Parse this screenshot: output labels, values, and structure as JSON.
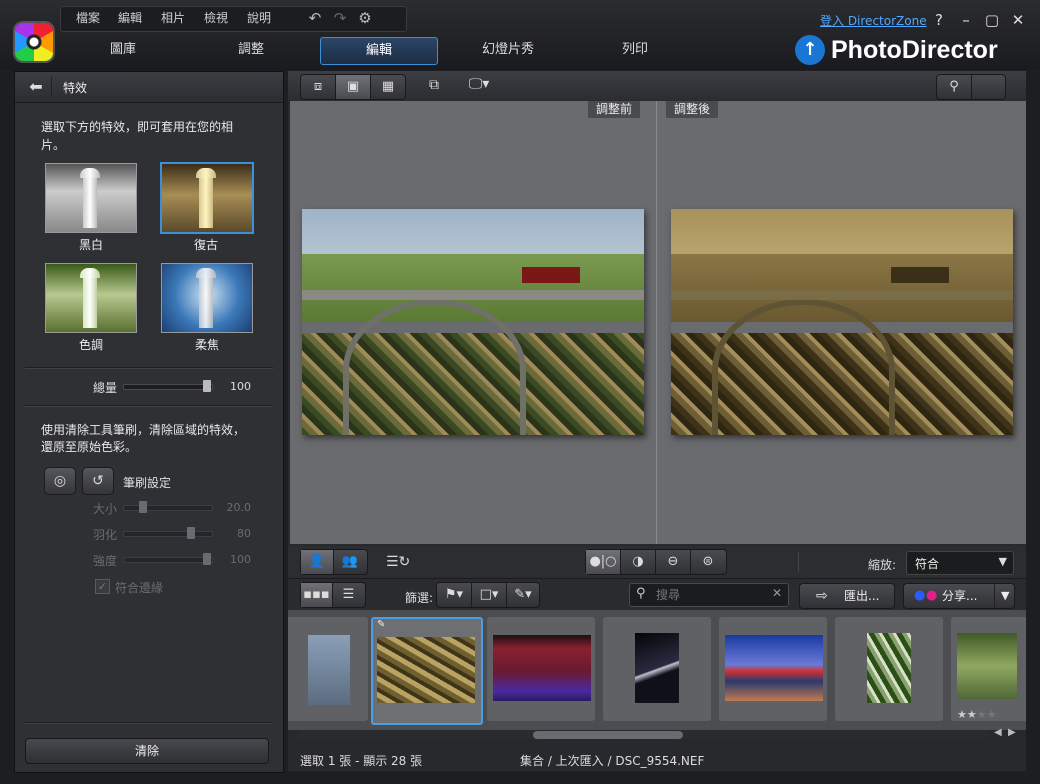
{
  "menu": {
    "file": "檔案",
    "edit": "編輯",
    "photo": "相片",
    "view": "檢視",
    "help": "說明"
  },
  "header": {
    "login": "登入 DirectorZone",
    "help": "?",
    "brand": "PhotoDirector"
  },
  "modes": [
    {
      "label": "圖庫"
    },
    {
      "label": "調整"
    },
    {
      "label": "編輯"
    },
    {
      "label": "幻燈片秀"
    },
    {
      "label": "列印"
    }
  ],
  "left_panel": {
    "title": "特效",
    "description": "選取下方的特效，即可套用在您的相片。",
    "effects": [
      {
        "label": "黑白"
      },
      {
        "label": "復古"
      },
      {
        "label": "色調"
      },
      {
        "label": "柔焦"
      }
    ],
    "amount": {
      "label": "總量",
      "value": "100"
    },
    "brush_desc": "使用清除工具筆刷，清除區域的特效，還原至原始色彩。",
    "brush_settings": "筆刷設定",
    "size": {
      "label": "大小",
      "value": "20.0"
    },
    "feather": {
      "label": "羽化",
      "value": "80"
    },
    "strength": {
      "label": "強度",
      "value": "100"
    },
    "fit_edges": "符合邊緣",
    "clear": "清除"
  },
  "viewer": {
    "before": "調整前",
    "after": "調整後"
  },
  "zoom": {
    "label": "縮放:",
    "value": "符合"
  },
  "filter": {
    "label": "篩選:",
    "search_placeholder": "搜尋",
    "export": "匯出...",
    "share": "分享..."
  },
  "status": {
    "selection": "選取 1 張 - 顯示 28 張",
    "path": "集合 / 上次匯入 / DSC_9554.NEF"
  },
  "colors": {
    "accent": "#3d8fd8",
    "sepia": "#8a7640"
  }
}
